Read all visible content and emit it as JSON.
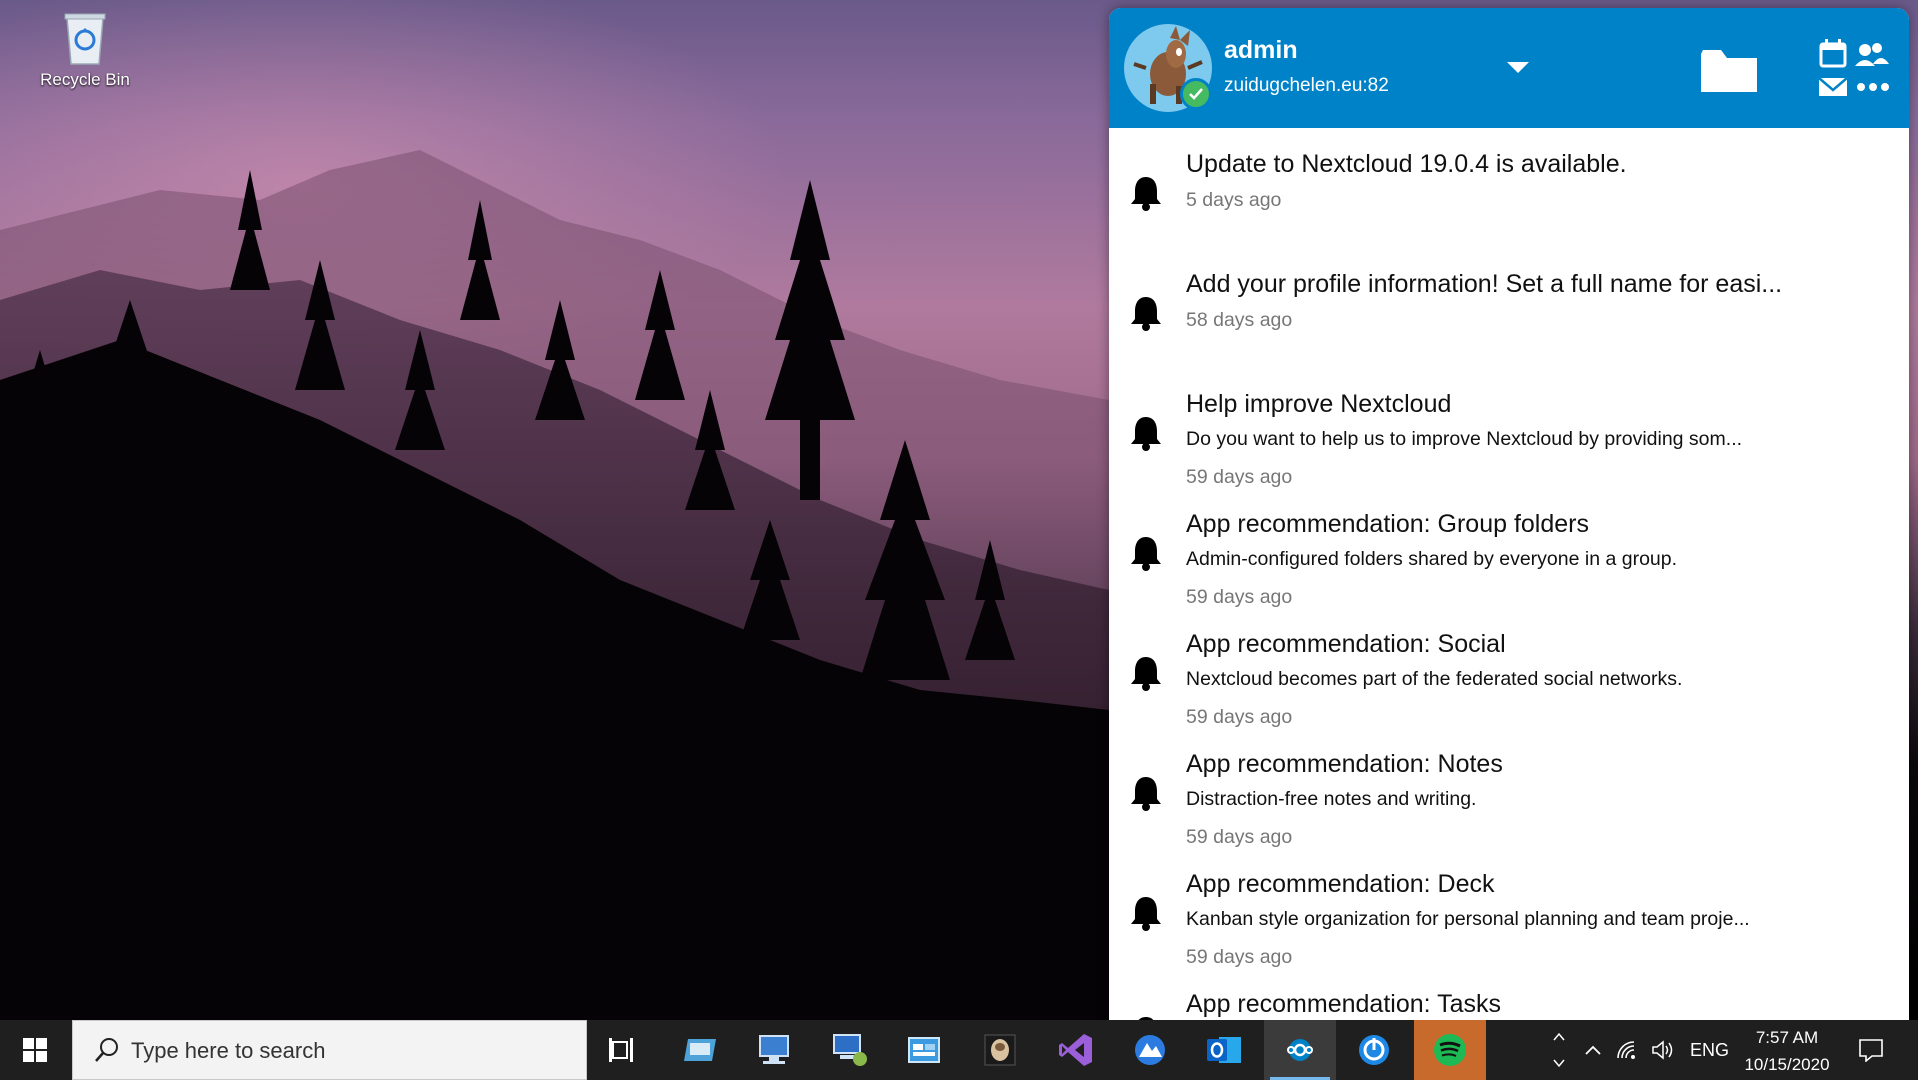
{
  "desktop": {
    "icons": [
      {
        "label": "Recycle Bin",
        "icon": "recycle-bin-icon"
      }
    ]
  },
  "nextcloud": {
    "header": {
      "username": "admin",
      "server": "zuidugchelen.eu:82",
      "status": "online",
      "accent": "#0082c9",
      "status_color": "#46ba61"
    },
    "notifications": [
      {
        "title": "Update to Nextcloud 19.0.4 is available.",
        "description": "",
        "time": "5 days ago"
      },
      {
        "title": "Add your profile information! Set a full name for easi...",
        "description": "",
        "time": "58 days ago"
      },
      {
        "title": "Help improve Nextcloud",
        "description": "Do you want to help us to improve Nextcloud by providing som...",
        "time": "59 days ago"
      },
      {
        "title": "App recommendation: Group folders",
        "description": "Admin-configured folders shared by everyone in a group.",
        "time": "59 days ago"
      },
      {
        "title": "App recommendation: Social",
        "description": "Nextcloud becomes part of the federated social networks.",
        "time": "59 days ago"
      },
      {
        "title": "App recommendation: Notes",
        "description": "Distraction-free notes and writing.",
        "time": "59 days ago"
      },
      {
        "title": "App recommendation: Deck",
        "description": "Kanban style organization for personal planning and team proje...",
        "time": "59 days ago"
      },
      {
        "title": "App recommendation: Tasks",
        "description": "",
        "time": ""
      }
    ]
  },
  "taskbar": {
    "search_placeholder": "Type here to search",
    "pinned": [
      "task-view-icon",
      "remote-desktop-manager-icon",
      "network-computer-icon",
      "remote-desktop-icon",
      "control-panel-icon",
      "photo-app-icon",
      "visual-studio-icon",
      "browser-icon",
      "outlook-icon",
      "nextcloud-icon",
      "update-icon",
      "spotify-icon"
    ],
    "tray": {
      "language": "ENG",
      "time": "7:57 AM",
      "date": "10/15/2020"
    }
  }
}
